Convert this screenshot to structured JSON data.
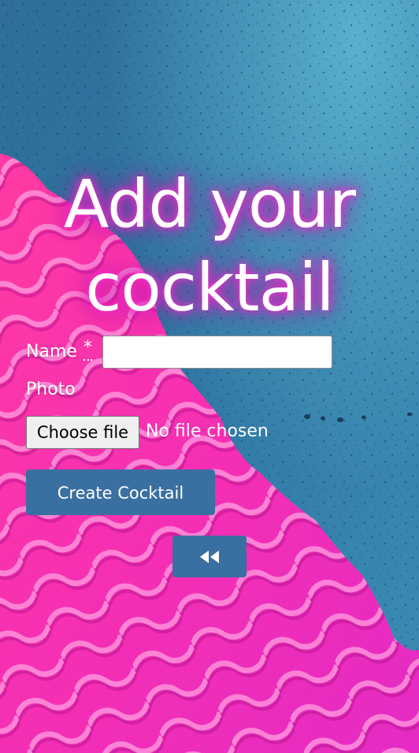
{
  "page": {
    "title": "Add your cocktail"
  },
  "form": {
    "name_label": "Name",
    "required_marker": "*",
    "name_value": "",
    "photo_label": "Photo",
    "file_button_label": "Choose file",
    "file_status": "No file chosen",
    "submit_label": "Create Cocktail",
    "back_icon": "rewind-icon"
  },
  "colors": {
    "button": "#3a6fa1",
    "title_glow": "#ff2fd0",
    "background_pink": "#ff2fa0",
    "background_blue": "#2f6f9a"
  }
}
